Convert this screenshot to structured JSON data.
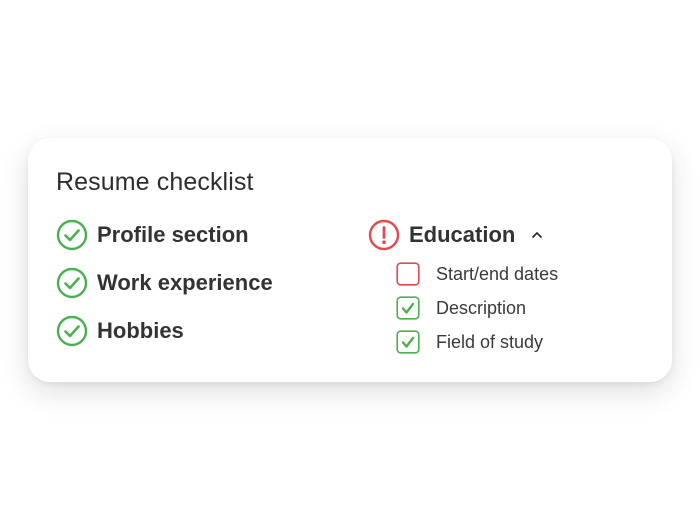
{
  "card": {
    "title": "Resume checklist"
  },
  "left_items": [
    {
      "label": "Profile section",
      "status": "complete",
      "icon": "check-circle-icon"
    },
    {
      "label": "Work experience",
      "status": "complete",
      "icon": "check-circle-icon"
    },
    {
      "label": "Hobbies",
      "status": "complete",
      "icon": "check-circle-icon"
    }
  ],
  "education": {
    "label": "Education",
    "status": "warning",
    "icon": "alert-circle-icon",
    "expanded": true,
    "sub_items": [
      {
        "label": "Start/end dates",
        "checked": false
      },
      {
        "label": "Description",
        "checked": true
      },
      {
        "label": "Field of study",
        "checked": true
      }
    ]
  },
  "colors": {
    "success": "#4caf50",
    "error": "#e5484d",
    "text": "#333333"
  }
}
